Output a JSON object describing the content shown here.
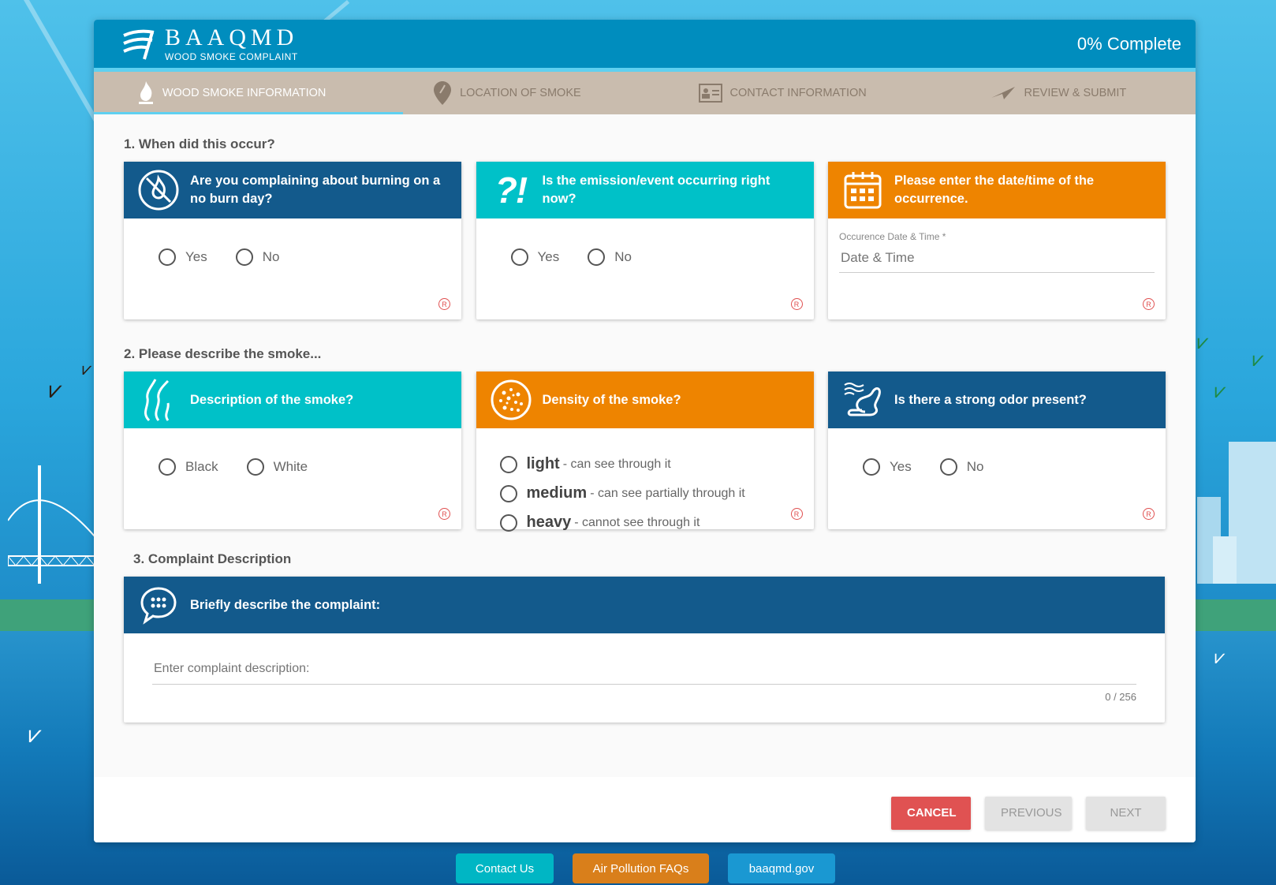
{
  "header": {
    "logo_title": "BAAQMD",
    "logo_subtitle": "WOOD SMOKE COMPLAINT",
    "progress": "0% Complete",
    "progress_value": 0
  },
  "steps": [
    {
      "label": "WOOD SMOKE INFORMATION",
      "icon": "flame-icon",
      "active": true
    },
    {
      "label": "LOCATION OF SMOKE",
      "icon": "map-pin-icon",
      "active": false
    },
    {
      "label": "CONTACT INFORMATION",
      "icon": "id-card-icon",
      "active": false
    },
    {
      "label": "REVIEW & SUBMIT",
      "icon": "paper-plane-icon",
      "active": false
    }
  ],
  "section1": {
    "title": "1. When did this occur?",
    "q1": {
      "question": "Are you complaining about burning on a no burn day?",
      "yes": "Yes",
      "no": "No"
    },
    "q2": {
      "question": "Is the emission/event occurring right now?",
      "yes": "Yes",
      "no": "No"
    },
    "q3": {
      "question": "Please enter the date/time of the occurrence.",
      "field_label": "Occurence Date & Time *",
      "placeholder": "Date & Time"
    }
  },
  "section2": {
    "title": "2. Please describe the smoke...",
    "q1": {
      "question": "Description of the smoke?",
      "black": "Black",
      "white": "White"
    },
    "q2": {
      "question": "Density of the smoke?",
      "options": [
        {
          "term": "light",
          "desc": "- can see through it"
        },
        {
          "term": "medium",
          "desc": "- can see partially through it"
        },
        {
          "term": "heavy",
          "desc": "- cannot see through it"
        }
      ]
    },
    "q3": {
      "question": "Is there a strong odor present?",
      "yes": "Yes",
      "no": "No"
    }
  },
  "section3": {
    "title": "3. Complaint Description",
    "question": "Briefly describe the complaint:",
    "placeholder": "Enter complaint description:",
    "counter": "0 / 256"
  },
  "required_mark": "R",
  "buttons": {
    "cancel": "CANCEL",
    "previous": "PREVIOUS",
    "next": "NEXT"
  },
  "links": {
    "contact": "Contact Us",
    "faqs": "Air Pollution FAQs",
    "site": "baaqmd.gov"
  },
  "colors": {
    "navy": "#135a8c",
    "teal": "#00c1c8",
    "orange": "#ee8400",
    "header_blue": "#008dbe",
    "cancel_red": "#e05252"
  }
}
